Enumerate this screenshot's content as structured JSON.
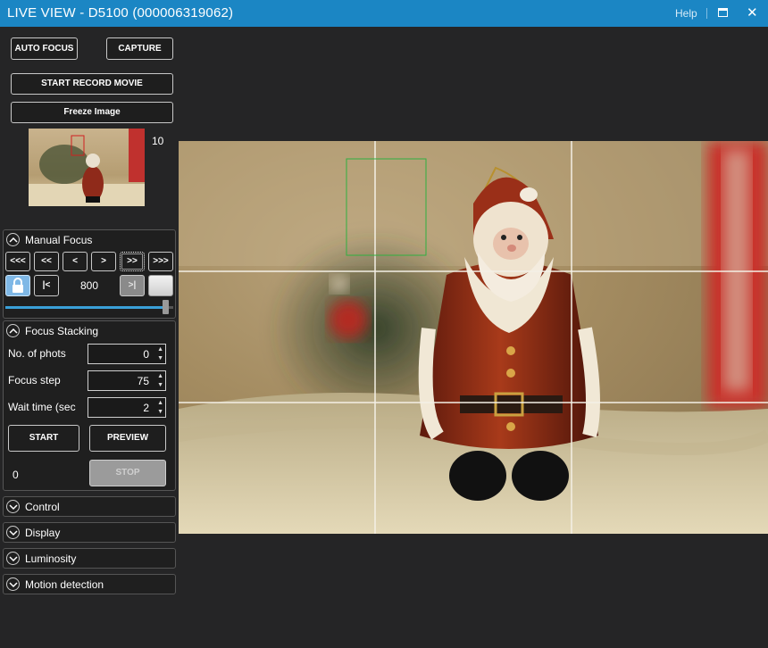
{
  "window": {
    "title": "LIVE VIEW - D5100 (000006319062)",
    "help": "Help"
  },
  "buttons": {
    "auto_focus": "AUTO FOCUS",
    "capture": "CAPTURE",
    "start_record_movie": "START RECORD MOVIE",
    "freeze_image": "Freeze Image"
  },
  "thumbnail": {
    "count": "10"
  },
  "manual_focus": {
    "title": "Manual Focus",
    "steps": [
      "<<<",
      "<<",
      "<",
      ">",
      ">>",
      ">>>"
    ],
    "first_label": "|<",
    "position": "800",
    "last_label": ">|",
    "slider_fraction": 0.97
  },
  "focus_stacking": {
    "title": "Focus Stacking",
    "fields": [
      {
        "label": "No. of phots",
        "value": "0"
      },
      {
        "label": "Focus step",
        "value": "75"
      },
      {
        "label": "Wait time (sec",
        "value": "2"
      }
    ],
    "start": "START",
    "preview": "PREVIEW",
    "counter": "0",
    "stop": "STOP"
  },
  "panels": {
    "control": "Control",
    "display": "Display",
    "luminosity": "Luminosity",
    "motion_detection": "Motion detection"
  },
  "colors": {
    "titlebar": "#1b86c4",
    "background": "#252526",
    "accent": "#3aa0d8"
  }
}
